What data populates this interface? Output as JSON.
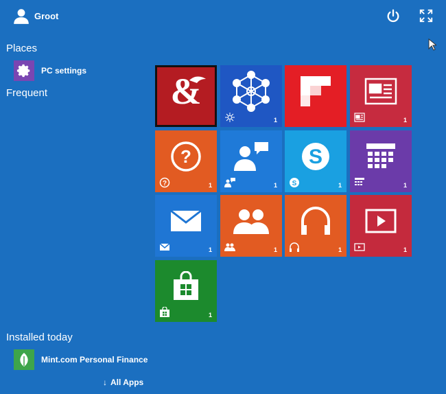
{
  "user": {
    "name": "Groot"
  },
  "sections": {
    "places": "Places",
    "frequent": "Frequent",
    "installed": "Installed today"
  },
  "places_items": [
    {
      "label": "PC settings"
    }
  ],
  "installed_items": [
    {
      "label": "Mint.com Personal Finance"
    }
  ],
  "all_apps": {
    "label": "All Apps",
    "arrow": "↓"
  },
  "tiles": [
    {
      "name": "dungeons-dragons",
      "color": "#b41c22",
      "badge": ""
    },
    {
      "name": "network",
      "color": "#1f57c3",
      "badge": "1"
    },
    {
      "name": "flipboard",
      "color": "#e41e25",
      "badge": ""
    },
    {
      "name": "news",
      "color": "#c62b3f",
      "badge": "1"
    },
    {
      "name": "help",
      "color": "#e25b22",
      "badge": "1"
    },
    {
      "name": "people-chat",
      "color": "#1f7ad8",
      "badge": "1"
    },
    {
      "name": "skype",
      "color": "#1aa0e1",
      "badge": "1"
    },
    {
      "name": "calendar",
      "color": "#6b3ba9",
      "badge": "1"
    },
    {
      "name": "mail",
      "color": "#1f76d4",
      "badge": "1"
    },
    {
      "name": "people",
      "color": "#e25b22",
      "badge": "1"
    },
    {
      "name": "music",
      "color": "#e25b22",
      "badge": "1"
    },
    {
      "name": "video",
      "color": "#c42a3d",
      "badge": "1"
    },
    {
      "name": "store",
      "color": "#1c8a2d",
      "badge": "1"
    }
  ]
}
